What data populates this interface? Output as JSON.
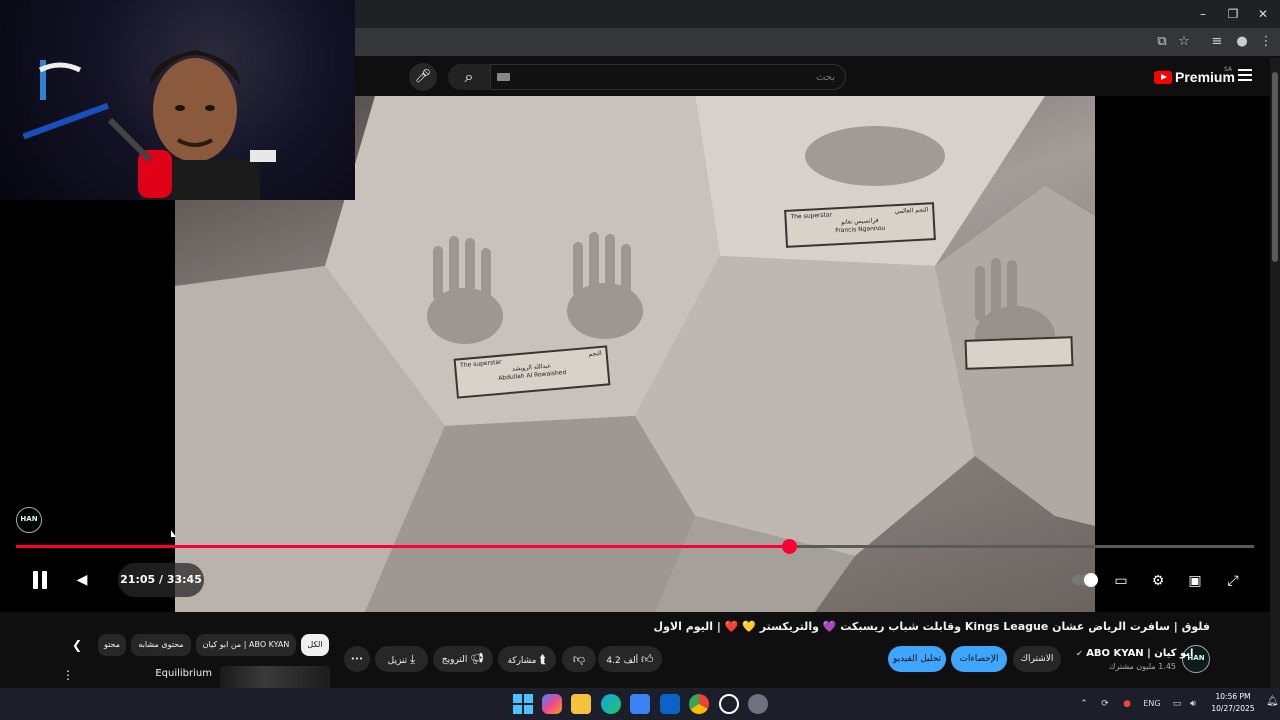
{
  "window": {
    "minimize_glyph": "–",
    "restore_glyph": "❐",
    "close_glyph": "✕"
  },
  "header": {
    "search_placeholder": "بحث",
    "logo_text": "Premium",
    "region": "SA"
  },
  "player": {
    "current_time": "21:05",
    "duration": "33:45",
    "time_display": "21:05 / 33:45",
    "progress_fraction": 0.624,
    "channel_watermark": "HAN"
  },
  "plaques": [
    {
      "title_en": "The superstar",
      "title_ar": "النجم",
      "name_ar": "عبدالله الرويشد",
      "name_en": "Abdullah Al Rowaished"
    },
    {
      "title_en": "The superstar",
      "title_ar": "النجم العالمي",
      "name_ar": "فرانسيس نغانو",
      "name_en": "Francis Ngannou"
    }
  ],
  "video": {
    "title": "فلوق | سافرت الرياض عشان Kings League وقابلت شباب ريسبكت 💜 والتريكستر 💛 ❤️ | اليوم الاول",
    "channel_name": "ABO KYAN | ابو كيان",
    "channel_verified": "✔",
    "subscribers": "1.45 مليون مشترك",
    "avatar_text": "HAN",
    "subscribe_label": "الاشتراك",
    "stats_label": "الإحصاءات",
    "edit_label": "تحليل الفيديو",
    "likes": "4.2 ألف",
    "share_label": "مشاركة",
    "promote_label": "الترويج",
    "download_label": "تنزيل",
    "more_glyph": "•••"
  },
  "chips": [
    {
      "label": "الكل",
      "active": true
    },
    {
      "label": "من ابو كيان | ABO KYAN",
      "active": false
    },
    {
      "label": "محتوى مشابه",
      "active": false
    },
    {
      "label": "محتو",
      "active": false
    }
  ],
  "recommendation": {
    "title": "Equilibrium"
  },
  "taskbar": {
    "lang": "ENG",
    "time": "10:56 PM",
    "date": "10/27/2025"
  },
  "colors": {
    "progress": "#ff0033",
    "accent_blue": "#3ea6ff",
    "youtube_red": "#ff0000"
  }
}
